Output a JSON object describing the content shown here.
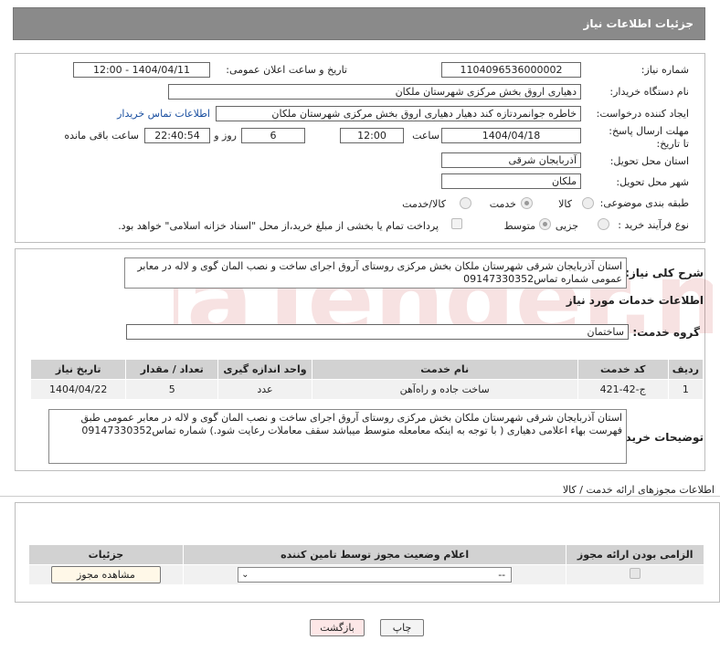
{
  "header": {
    "title": "جزئیات اطلاعات نیاز"
  },
  "form": {
    "need_number_label": "شماره نیاز:",
    "need_number": "1104096536000002",
    "announce_label": "تاریخ و ساعت اعلان عمومی:",
    "announce_value": "1404/04/11 - 12:00",
    "buyer_label": "نام دستگاه خریدار:",
    "buyer_value": "دهیاری اروق بخش مرکزی شهرستان ملکان",
    "creator_label": "ایجاد کننده درخواست:",
    "creator_value": "خاطره جوانمردتازه کند دهیار دهیاری اروق بخش مرکزی شهرستان ملکان",
    "contact_link": "اطلاعات تماس خریدار",
    "deadline_label": "مهلت ارسال پاسخ: تا تاریخ:",
    "deadline_date": "1404/04/18",
    "time_label": "ساعت",
    "deadline_time": "12:00",
    "days_value": "6",
    "days_label": "روز و",
    "remaining_time": "22:40:54",
    "remaining_label": "ساعت باقی مانده",
    "province_label": "استان محل تحویل:",
    "province_value": "آذربایجان شرقی",
    "city_label": "شهر محل تحویل:",
    "city_value": "ملکان",
    "category_label": "طبقه بندی موضوعی:",
    "category_options": [
      "کالا",
      "خدمت",
      "کالا/خدمت"
    ],
    "category_selected": "خدمت",
    "process_label": "نوع فرآیند خرید :",
    "process_options": [
      "جزیی",
      "متوسط"
    ],
    "process_selected": "جزیی",
    "payment_note": "پرداخت تمام یا بخشی از مبلغ خرید،از محل \"اسناد خزانه اسلامی\" خواهد بود."
  },
  "summary": {
    "label": "شرح کلی نیاز:",
    "text": "استان آذربایجان شرقی شهرستان ملکان بخش مرکزی روستای آروق اجرای ساخت و نصب المان گوی و لاله در معابر عمومی  شماره تماس09147330352",
    "services_heading": "اطلاعات خدمات مورد نیاز",
    "service_group_label": "گروه خدمت:",
    "service_group_value": "ساختمان"
  },
  "services_table": {
    "headers": [
      "ردیف",
      "کد خدمت",
      "نام خدمت",
      "واحد اندازه گیری",
      "تعداد / مقدار",
      "تاریخ نیاز"
    ],
    "rows": [
      [
        "1",
        "ج-42-421",
        "ساخت جاده و راه‌آهن",
        "عدد",
        "5",
        "1404/04/22"
      ]
    ]
  },
  "buyer_notes": {
    "label": "توضیحات خریدار:",
    "text": "استان آذربایجان شرقی شهرستان ملکان بخش مرکزی روستای آروق اجرای ساخت و نصب المان گوی و لاله در معابر عمومی طبق فهرست بهاء اعلامی دهیاری ( با توجه به اینکه معامعله متوسط میباشد سقف معاملات رعایت شود.) شماره تماس09147330352"
  },
  "permits": {
    "heading": "اطلاعات مجوزهای ارائه خدمت / کالا",
    "headers": [
      "الزامی بودن ارائه مجوز",
      "اعلام وضعیت مجوز توسط تامین کننده",
      "جزئیات"
    ],
    "select_value": "--",
    "view_button": "مشاهده مجوز"
  },
  "footer": {
    "print_button": "چاپ",
    "back_button": "بازگشت"
  },
  "watermark": {
    "text": "AriaTender.neT"
  }
}
